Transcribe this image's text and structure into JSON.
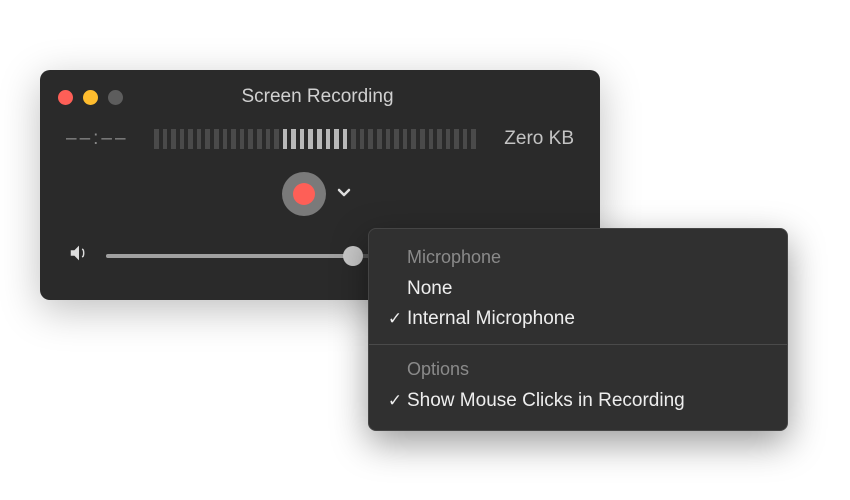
{
  "window": {
    "title": "Screen Recording",
    "time_display": "––:––",
    "file_size": "Zero KB"
  },
  "meter": {
    "segments": 38,
    "active_start": 15,
    "active_end": 22
  },
  "volume": {
    "percent": 53
  },
  "dropdown": {
    "microphone_section": "Microphone",
    "options_section": "Options",
    "items_microphone": [
      {
        "label": "None",
        "checked": false
      },
      {
        "label": "Internal Microphone",
        "checked": true
      }
    ],
    "items_options": [
      {
        "label": "Show Mouse Clicks in Recording",
        "checked": true
      }
    ]
  }
}
